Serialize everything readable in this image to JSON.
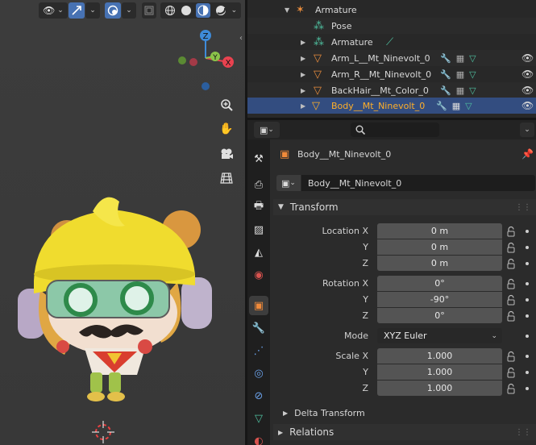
{
  "viewport": {
    "toolbar": {
      "view_icon": "eye-icon",
      "select_icon": "cursor-icon",
      "overlay_icon": "overlay-icon",
      "shading_modes": [
        "wireframe",
        "solid",
        "material",
        "rendered"
      ]
    },
    "gizmo": {
      "x": "X",
      "y": "Y",
      "z": "Z"
    },
    "nav_buttons": [
      "zoom-icon",
      "hand-icon",
      "camera-icon",
      "grid-icon"
    ],
    "colors": {
      "x_axis": "#e8424f",
      "y_axis": "#8bc34a",
      "z_axis": "#3e8bd9"
    }
  },
  "outliner": {
    "rows": [
      {
        "label": "Armature",
        "icon": "armature-icon",
        "kind": "armature"
      },
      {
        "label": "Pose",
        "icon": "pose-icon",
        "kind": "pose"
      },
      {
        "label": "Armature",
        "icon": "armature-data-icon",
        "kind": "armature-data"
      },
      {
        "label": "Arm_L__Mt_Ninevolt_0",
        "icon": "mesh-icon",
        "kind": "mesh"
      },
      {
        "label": "Arm_R__Mt_Ninevolt_0",
        "icon": "mesh-icon",
        "kind": "mesh"
      },
      {
        "label": "BackHair__Mt_Color_0",
        "icon": "mesh-icon",
        "kind": "mesh"
      },
      {
        "label": "Body__Mt_Ninevolt_0",
        "icon": "mesh-icon",
        "kind": "mesh",
        "selected": true
      }
    ]
  },
  "properties": {
    "search_placeholder": "",
    "object_name": "Body__Mt_Ninevolt_0",
    "data_block_name": "Body__Mt_Ninevolt_0",
    "transform": {
      "title": "Transform",
      "location_label": "Location X",
      "location": [
        "0 m",
        "0 m",
        "0 m"
      ],
      "rotation_label": "Rotation X",
      "rotation": [
        "0°",
        "-90°",
        "0°"
      ],
      "mode_label": "Mode",
      "mode": "XYZ Euler",
      "scale_label": "Scale X",
      "scale": [
        "1.000",
        "1.000",
        "1.000"
      ],
      "axis_y": "Y",
      "axis_z": "Z"
    },
    "delta_transform": "Delta Transform",
    "relations": "Relations",
    "tabs": [
      "tool-icon",
      "render-icon",
      "output-icon",
      "view-layer-icon",
      "scene-icon",
      "world-icon",
      "object-icon",
      "modifier-icon",
      "particles-icon",
      "physics-icon",
      "constraints-icon",
      "data-icon",
      "material-icon"
    ]
  }
}
